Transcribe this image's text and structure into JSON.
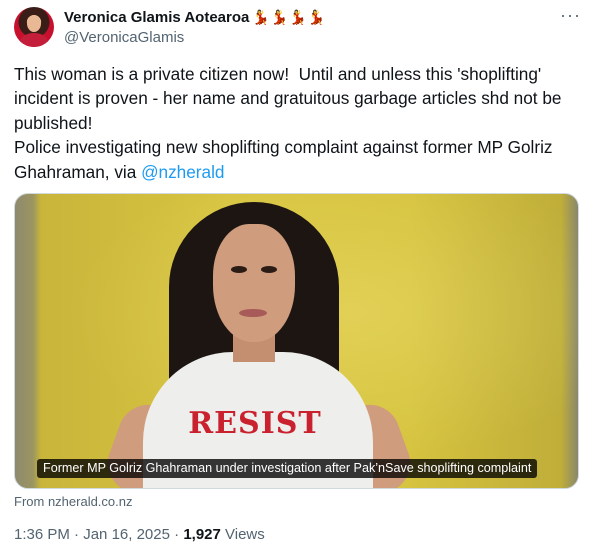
{
  "author": {
    "display_name": "Veronica Glamis Aotearoa",
    "emojis": "💃💃💃💃",
    "handle": "@VeronicaGlamis",
    "more_icon": "more-horizontal-icon"
  },
  "tweet": {
    "text_line1": "This woman is a private citizen now!  Until and unless this 'shoplifting' incident is proven - her name and gratuitous garbage articles shd not be published!",
    "text_line2_prefix": "Police investigating new shoplifting complaint against former MP Golriz Ghahraman, via ",
    "mention": "@nzherald"
  },
  "media": {
    "shirt_text": "RESIST",
    "caption": "Former MP Golriz Ghahraman under investigation after Pak’nSave shoplifting complaint"
  },
  "link_source": "From nzherald.co.nz",
  "meta": {
    "time": "1:36 PM",
    "separator1": " · ",
    "date": "Jan 16, 2025",
    "separator2": " · ",
    "views_count": "1,927",
    "views_label": " Views"
  },
  "colors": {
    "link": "#1d9bf0",
    "secondary_text": "#536471",
    "primary_text": "#0f1419",
    "backdrop_yellow": "#d6c33f"
  }
}
